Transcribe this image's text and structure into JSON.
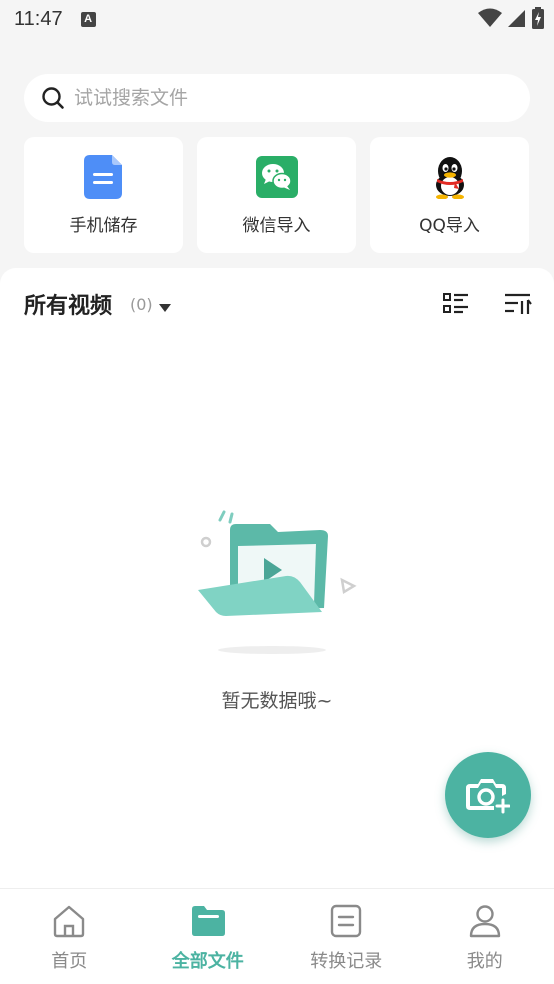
{
  "status_bar": {
    "time": "11:47",
    "badge": "A"
  },
  "search": {
    "placeholder": "试试搜索文件"
  },
  "sources": [
    {
      "label": "手机储存",
      "icon": "file-document-icon"
    },
    {
      "label": "微信导入",
      "icon": "wechat-icon"
    },
    {
      "label": "QQ导入",
      "icon": "qq-penguin-icon"
    }
  ],
  "section": {
    "title": "所有视频",
    "count": "(0)"
  },
  "empty": {
    "text": "暂无数据哦~"
  },
  "tabs": [
    {
      "label": "首页",
      "icon": "home-icon",
      "active": false
    },
    {
      "label": "全部文件",
      "icon": "folder-icon",
      "active": true
    },
    {
      "label": "转换记录",
      "icon": "list-record-icon",
      "active": false
    },
    {
      "label": "我的",
      "icon": "user-icon",
      "active": false
    }
  ],
  "colors": {
    "accent": "#4cb3a2",
    "background": "#f5f5f5",
    "doc_blue": "#4e8ef7",
    "wechat_green": "#2aae67"
  }
}
